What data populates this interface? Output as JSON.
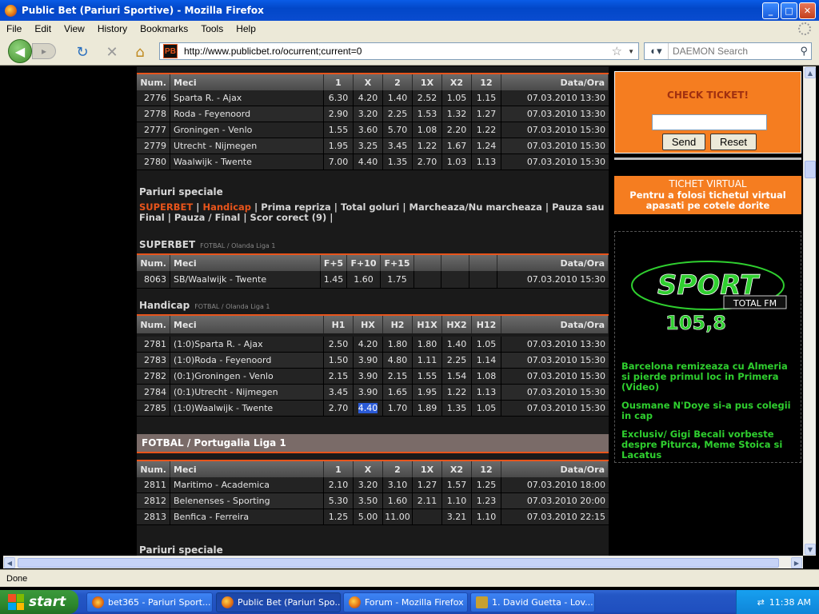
{
  "window": {
    "title": "Public Bet (Pariuri Sportive) - Mozilla Firefox"
  },
  "menu": [
    "File",
    "Edit",
    "View",
    "History",
    "Bookmarks",
    "Tools",
    "Help"
  ],
  "nav": {
    "url": "http://www.publicbet.ro/ocurrent;current=0",
    "search_placeholder": "DAEMON Search",
    "site_icon": "PB"
  },
  "status": "Done",
  "table1": {
    "headers": [
      "Num.",
      "Meci",
      "1",
      "X",
      "2",
      "1X",
      "X2",
      "12",
      "Data/Ora"
    ],
    "rows": [
      [
        "2776",
        "Sparta R. - Ajax",
        "6.30",
        "4.20",
        "1.40",
        "2.52",
        "1.05",
        "1.15",
        "07.03.2010 13:30"
      ],
      [
        "2778",
        "Roda - Feyenoord",
        "2.90",
        "3.20",
        "2.25",
        "1.53",
        "1.32",
        "1.27",
        "07.03.2010 13:30"
      ],
      [
        "2777",
        "Groningen - Venlo",
        "1.55",
        "3.60",
        "5.70",
        "1.08",
        "2.20",
        "1.22",
        "07.03.2010 15:30"
      ],
      [
        "2779",
        "Utrecht - Nijmegen",
        "1.95",
        "3.25",
        "3.45",
        "1.22",
        "1.67",
        "1.24",
        "07.03.2010 15:30"
      ],
      [
        "2780",
        "Waalwijk - Twente",
        "7.00",
        "4.40",
        "1.35",
        "2.70",
        "1.03",
        "1.13",
        "07.03.2010 15:30"
      ]
    ]
  },
  "specials": {
    "title": "Pariuri speciale",
    "links": [
      "SUPERBET",
      "Handicap",
      "Prima repriza",
      "Total goluri",
      "Marcheaza/Nu marcheaza",
      "Pauza sau Final",
      "Pauza / Final",
      "Scor corect (9)"
    ]
  },
  "superbet": {
    "title": "SUPERBET",
    "sub": "FOTBAL / Olanda Liga 1",
    "headers": [
      "Num.",
      "Meci",
      "F+5",
      "F+10",
      "F+15",
      "",
      "",
      "",
      "Data/Ora"
    ],
    "rows": [
      [
        "8063",
        "SB/Waalwijk - Twente",
        "1.45",
        "1.60",
        "1.75",
        "",
        "",
        "",
        "07.03.2010 15:30"
      ]
    ]
  },
  "handicap": {
    "title": "Handicap",
    "sub": "FOTBAL / Olanda Liga 1",
    "headers": [
      "Num.",
      "Meci",
      "H1",
      "HX",
      "H2",
      "H1X",
      "HX2",
      "H12",
      "Data/Ora"
    ],
    "rows": [
      [
        "2781",
        "(1:0)Sparta R. - Ajax",
        "2.50",
        "4.20",
        "1.80",
        "1.80",
        "1.40",
        "1.05",
        "07.03.2010 13:30"
      ],
      [
        "2783",
        "(1:0)Roda - Feyenoord",
        "1.50",
        "3.90",
        "4.80",
        "1.11",
        "2.25",
        "1.14",
        "07.03.2010 15:30"
      ],
      [
        "2782",
        "(0:1)Groningen - Venlo",
        "2.15",
        "3.90",
        "2.15",
        "1.55",
        "1.54",
        "1.08",
        "07.03.2010 15:30"
      ],
      [
        "2784",
        "(0:1)Utrecht - Nijmegen",
        "3.45",
        "3.90",
        "1.65",
        "1.95",
        "1.22",
        "1.13",
        "07.03.2010 15:30"
      ],
      [
        "2785",
        "(1:0)Waalwijk - Twente",
        "2.70",
        "4.40",
        "1.70",
        "1.89",
        "1.35",
        "1.05",
        "07.03.2010 15:30"
      ]
    ]
  },
  "portugal": {
    "band": "FOTBAL / Portugalia Liga 1",
    "headers": [
      "Num.",
      "Meci",
      "1",
      "X",
      "2",
      "1X",
      "X2",
      "12",
      "Data/Ora"
    ],
    "rows": [
      [
        "2811",
        "Maritimo - Academica",
        "2.10",
        "3.20",
        "3.10",
        "1.27",
        "1.57",
        "1.25",
        "07.03.2010 18:00"
      ],
      [
        "2812",
        "Belenenses - Sporting",
        "5.30",
        "3.50",
        "1.60",
        "2.11",
        "1.10",
        "1.23",
        "07.03.2010 20:00"
      ],
      [
        "2813",
        "Benfica - Ferreira",
        "1.25",
        "5.00",
        "11.00",
        "",
        "3.21",
        "1.10",
        "07.03.2010 22:15"
      ]
    ],
    "next_title": "Pariuri speciale"
  },
  "sidebar": {
    "ticket_title": "CHECK TICKET!",
    "send": "Send",
    "reset": "Reset",
    "virtual_title": "TICHET VIRTUAL",
    "virtual_text": "Pentru a folosi tichetul virtual apasati pe cotele dorite",
    "radio_name": "SPORT",
    "radio_sub": "TOTAL FM",
    "radio_freq": "105,8",
    "news": [
      "Barcelona remizeaza cu Almeria si pierde primul loc in Primera (Video)",
      "Ousmane N'Doye si-a pus colegii in cap",
      "Exclusiv/ Gigi Becali vorbeste despre Piturca, Meme Stoica si Lacatus"
    ]
  },
  "taskbar": {
    "start": "start",
    "tasks": [
      "bet365 - Pariuri Sport...",
      "Public Bet (Pariuri Spo...",
      "Forum - Mozilla Firefox",
      "1. David Guetta - Lov..."
    ],
    "clock": "11:38 AM"
  },
  "colors": {
    "accent": "#e8541b",
    "sidebar_orange": "#f57d20",
    "news_green": "#2fcf2f"
  }
}
